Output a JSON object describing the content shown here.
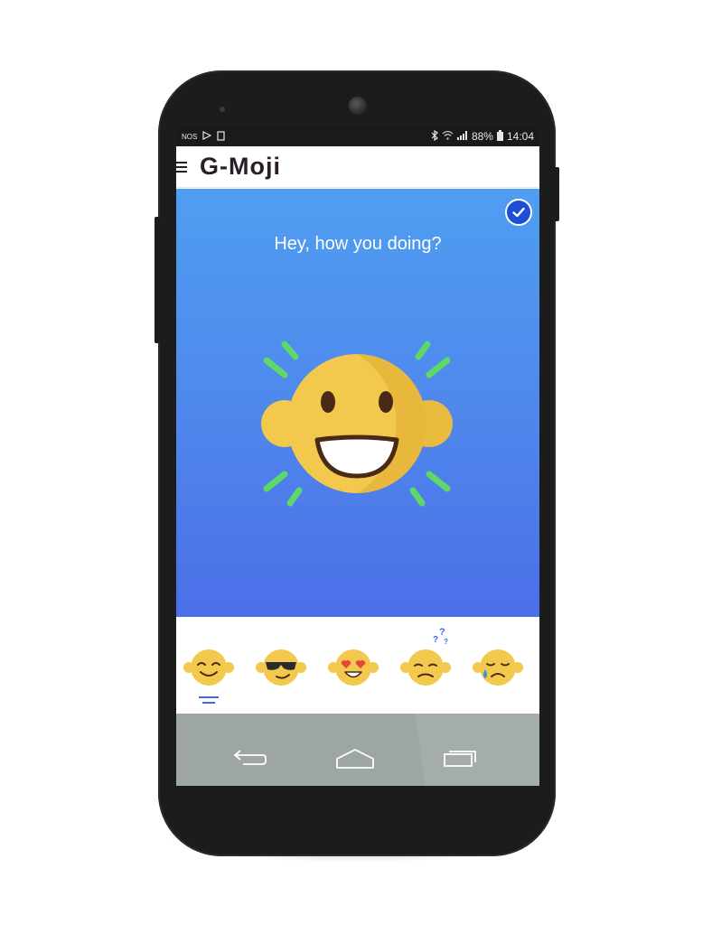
{
  "status_bar": {
    "carrier": "NOS",
    "battery": "88%",
    "time": "14:04"
  },
  "app": {
    "title": "G-Moji"
  },
  "hero": {
    "greeting": "Hey, how you doing?",
    "main_emoji": "big-smile"
  },
  "emoji_picker": {
    "items": [
      {
        "name": "smiling"
      },
      {
        "name": "cool-sunglasses"
      },
      {
        "name": "heart-eyes"
      },
      {
        "name": "confused"
      },
      {
        "name": "sad-tear"
      }
    ],
    "selected_index": 0
  },
  "colors": {
    "hero_top": "#4f9ef1",
    "hero_bottom": "#4b6fe8",
    "emoji_yellow": "#f2c94c",
    "accent_blue": "#1d4ed8",
    "sparkle_green": "#5fd86a",
    "navbar_gray": "#9ea6a5"
  }
}
